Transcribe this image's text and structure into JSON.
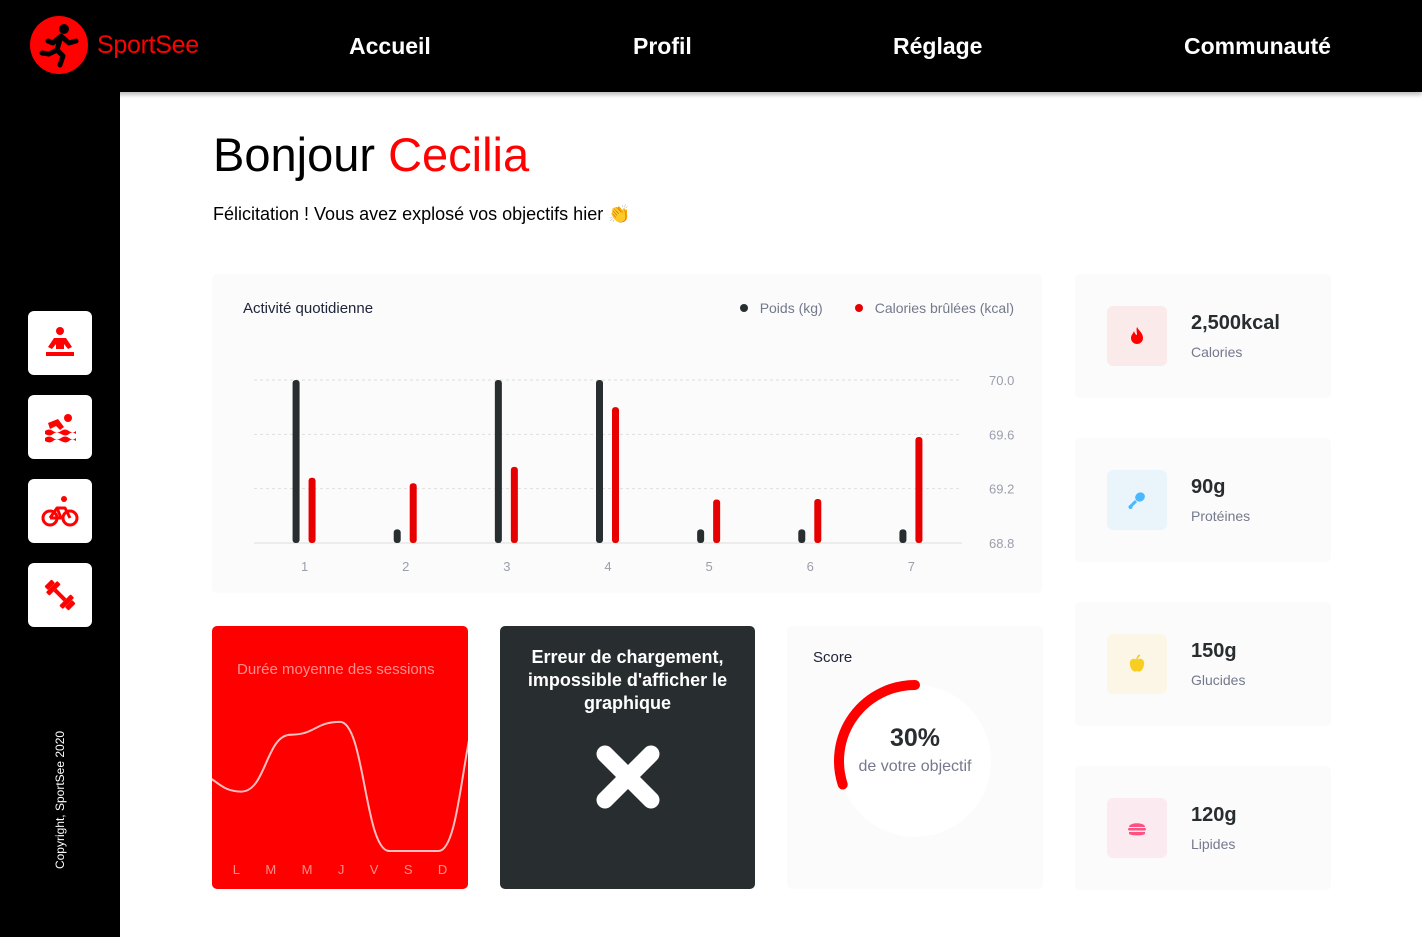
{
  "brand": {
    "name": "SportSee",
    "accent": "#ff0101"
  },
  "nav": {
    "home": "Accueil",
    "profile": "Profil",
    "settings": "Réglage",
    "community": "Communauté"
  },
  "sidebar": {
    "items": [
      {
        "label": "meditation",
        "icon": "yoga-icon"
      },
      {
        "label": "swimming",
        "icon": "swim-icon"
      },
      {
        "label": "cycling",
        "icon": "bike-icon"
      },
      {
        "label": "weights",
        "icon": "dumbbell-icon"
      }
    ],
    "copyright": "Copyright, SportSee 2020"
  },
  "header": {
    "greeting": "Bonjour",
    "user_name": "Cecilia",
    "message": "Félicitation ! Vous avez explosé vos objectifs hier 👏"
  },
  "activity": {
    "title": "Activité quotidienne",
    "legend_weight": "Poids (kg)",
    "legend_calories": "Calories brûlées (kcal)",
    "weight_color": "#282d30",
    "calories_color": "#e60000"
  },
  "chart_data": [
    {
      "type": "bar",
      "title": "Activité quotidienne",
      "categories": [
        "1",
        "2",
        "3",
        "4",
        "5",
        "6",
        "7"
      ],
      "series": [
        {
          "name": "Poids (kg)",
          "values": [
            70.0,
            68.9,
            70.0,
            70.0,
            68.9,
            68.9,
            68.9
          ]
        },
        {
          "name": "Calories brûlées (kcal)",
          "values": [
            240,
            220,
            280,
            500,
            160,
            162,
            390
          ]
        }
      ],
      "y_ticks": [
        "70.0",
        "69.6",
        "69.2",
        "68.8"
      ],
      "ylim": [
        68.8,
        70.0
      ],
      "calories_ylim": [
        0,
        600
      ],
      "legend": "top-right",
      "grid": true
    },
    {
      "type": "line",
      "title": "Durée moyenne des sessions",
      "categories": [
        "L",
        "M",
        "M",
        "J",
        "V",
        "S",
        "D"
      ],
      "values": [
        30,
        23,
        45,
        50,
        0,
        0,
        60
      ]
    },
    {
      "type": "pie",
      "title": "Score",
      "value": 0.3,
      "value_label": "30%",
      "caption": "de votre objectif"
    }
  ],
  "error": {
    "message": "Erreur de chargement, impossible d'afficher le graphique"
  },
  "score": {
    "title": "Score",
    "value_label": "30%",
    "caption": "de votre objectif"
  },
  "kpis": [
    {
      "value": "2,500kcal",
      "label": "Calories",
      "icon": "flame-icon",
      "color": "#ff0000",
      "bg": "#fbeaea"
    },
    {
      "value": "90g",
      "label": "Protéines",
      "icon": "chicken-leg-icon",
      "color": "#4ab8ff",
      "bg": "#e9f4fb"
    },
    {
      "value": "150g",
      "label": "Glucides",
      "icon": "apple-icon",
      "color": "#f9ce23",
      "bg": "#fbf6e5"
    },
    {
      "value": "120g",
      "label": "Lipides",
      "icon": "burger-icon",
      "color": "#fd5181",
      "bg": "#fbeaef"
    }
  ]
}
